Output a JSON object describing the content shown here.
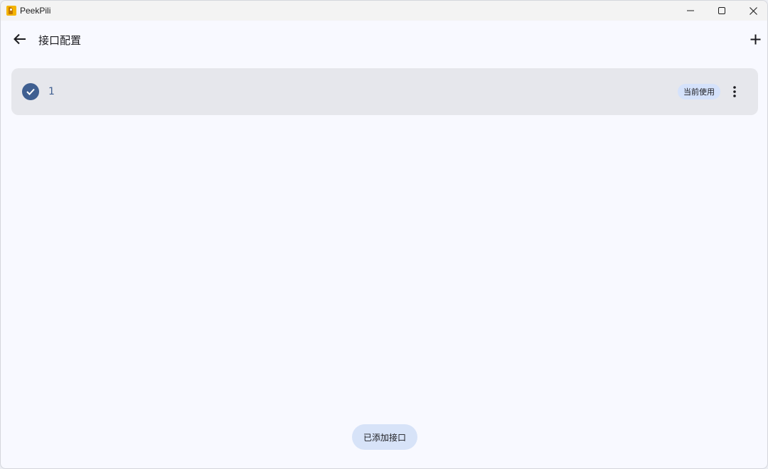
{
  "window": {
    "title": "PeekPili",
    "controls": {
      "minimize": "minimize-icon",
      "maximize": "maximize-icon",
      "close": "close-icon"
    }
  },
  "appbar": {
    "title": "接口配置",
    "back_icon": "arrow-back-icon",
    "add_icon": "add-icon"
  },
  "interfaces": [
    {
      "name": "1",
      "selected": true,
      "badge": "当前使用",
      "menu_icon": "more-vert-icon"
    }
  ],
  "snackbar": {
    "message": "已添加接口"
  },
  "colors": {
    "background": "#f8f9ff",
    "card": "#e6e7ec",
    "primary": "#3f5f91",
    "badge_bg": "#d5e2fb",
    "snackbar_bg": "#d7e3f8"
  }
}
